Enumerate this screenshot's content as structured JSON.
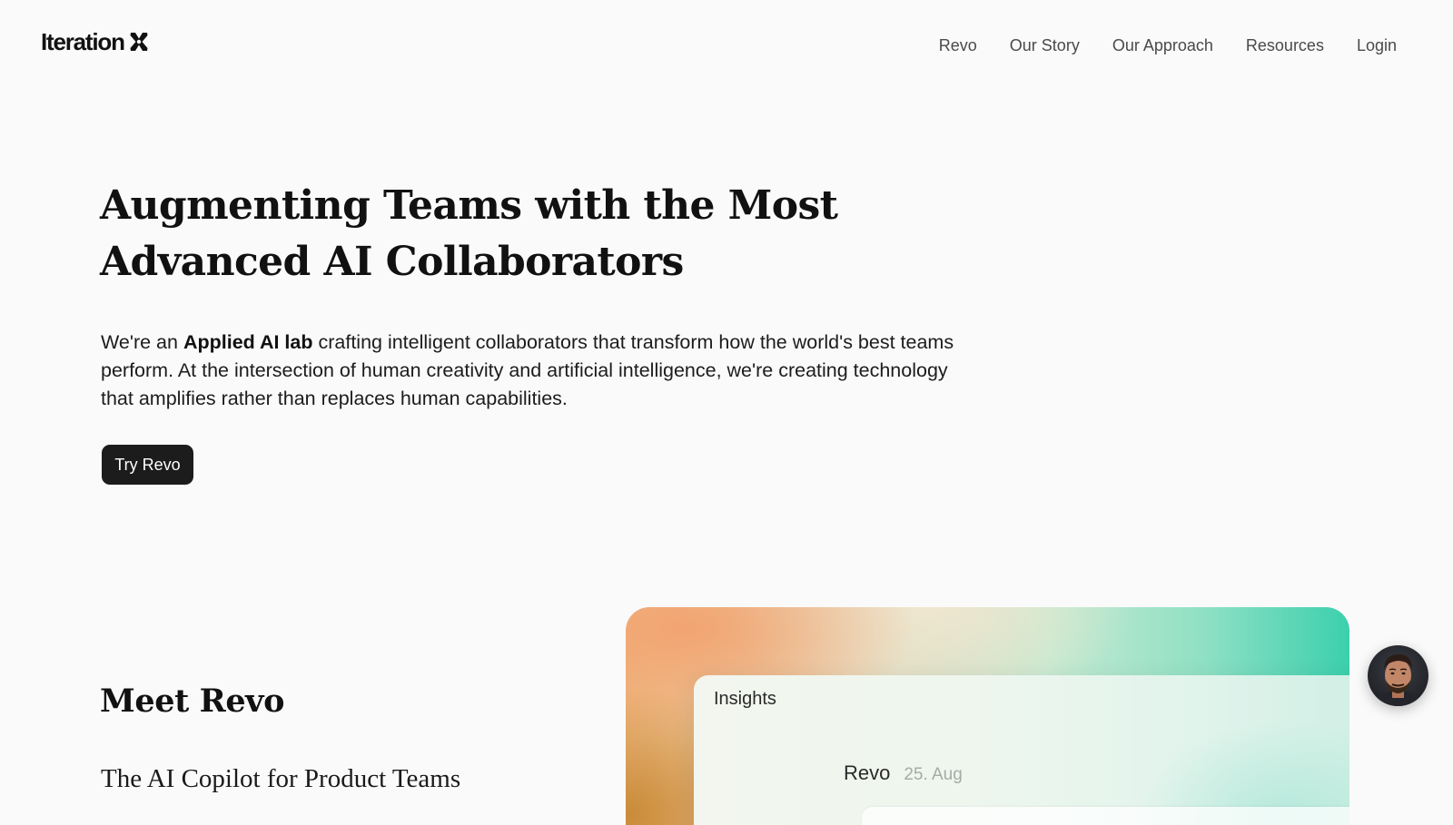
{
  "header": {
    "logo_text": "Iteration",
    "logo_icon": "x-mark-icon",
    "nav": [
      {
        "label": "Revo"
      },
      {
        "label": "Our Story"
      },
      {
        "label": "Our Approach"
      },
      {
        "label": "Resources"
      },
      {
        "label": "Login"
      }
    ]
  },
  "hero": {
    "title_line1": "Augmenting Teams with the Most",
    "title_line2": "Advanced AI Collaborators",
    "desc_prefix": "We're an ",
    "desc_bold": "Applied AI lab",
    "desc_rest": " crafting intelligent collaborators that transform how the world's best teams perform. At the intersection of human creativity and artificial intelligence, we're creating technology that amplifies rather than replaces human capabilities.",
    "cta_label": "Try Revo"
  },
  "meet": {
    "title": "Meet Revo",
    "subtitle": "The AI Copilot for Product Teams"
  },
  "preview": {
    "panel_title": "Insights",
    "message_author": "Revo",
    "message_date": "25. Aug"
  },
  "avatar": {
    "icon": "user-avatar-icon"
  },
  "colors": {
    "background": "#fafafa",
    "text": "#111111",
    "nav_text": "#4a4a4a",
    "button_bg": "#1c1c1c",
    "button_text": "#ffffff",
    "accent_teal": "#3cd0ad",
    "accent_orange": "#efb77f"
  }
}
